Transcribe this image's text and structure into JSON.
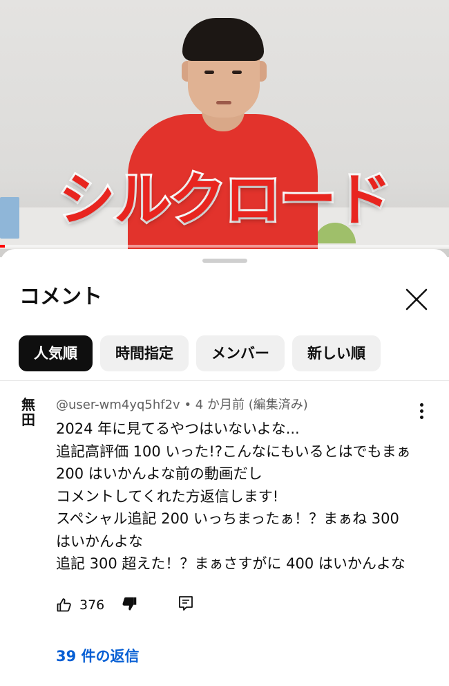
{
  "video": {
    "overlay_title": "シルクロード",
    "title_color": "#e8251f",
    "progress_fraction": 0.01
  },
  "comments_panel": {
    "title": "コメント",
    "close_icon": "close-icon",
    "sort_chips": [
      {
        "label": "人気順",
        "selected": true
      },
      {
        "label": "時間指定",
        "selected": false
      },
      {
        "label": "メンバー",
        "selected": false
      },
      {
        "label": "新しい順",
        "selected": false
      }
    ]
  },
  "comment": {
    "avatar_text": "無田",
    "author": "@user-wm4yq5hf2v",
    "separator": "•",
    "time": "4 か月前",
    "edited": "(編集済み)",
    "lines": [
      "2024 年に見てるやつはいないよな...",
      "追記高評価 100 いった!?こんなにもいるとはでもまぁ",
      " 200 はいかんよな前の動画だし",
      "コメントしてくれた方返信します!",
      "スペシャル追記 200 いっちまったぁ！？まぁね 300",
      "はいかんよな",
      "追記 300 超えた！？まぁさすがに 400 はいかんよな"
    ],
    "like_count": "376",
    "replies_label": "39 件の返信",
    "link_color": "#065fd4"
  }
}
